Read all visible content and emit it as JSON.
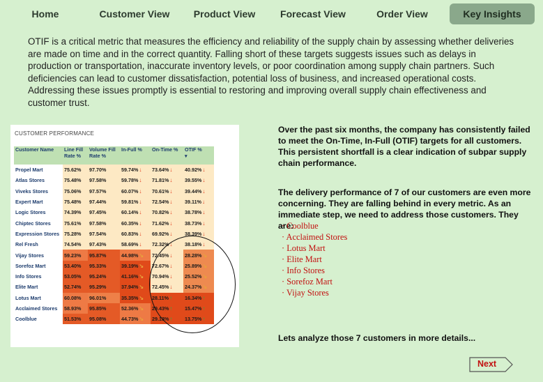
{
  "nav": {
    "items": [
      {
        "label": "Home"
      },
      {
        "label": "Customer View"
      },
      {
        "label": "Product View"
      },
      {
        "label": "Forecast View"
      },
      {
        "label": "Order View"
      },
      {
        "label": "Key Insights",
        "active": true
      }
    ]
  },
  "intro": "OTIF is a critical metric that measures the efficiency and reliability of the supply chain by assessing whether deliveries are made on time and in the correct quantity. Falling short of these targets suggests issues such as delays in production or transportation, inaccurate inventory levels, or poor coordination among supply chain partners. Such deficiencies can lead to customer dissatisfaction, potential loss of business, and increased operational costs. Addressing these issues promptly is essential to restoring and improving overall supply chain effectiveness and customer trust.",
  "table": {
    "title": "CUSTOMER PERFORMANCE",
    "headers": [
      "Customer Name",
      "Line Fill Rate %",
      "Volume Fill Rate %",
      "In-Full %",
      "On-Time %",
      "OTIF %"
    ],
    "sort_indicator": "▾",
    "rows": [
      {
        "name": "Propel Mart",
        "lfr": "75.62%",
        "vfr": "97.70%",
        "inf": "59.74%",
        "ot": "73.64%",
        "otif": "40.92%"
      },
      {
        "name": "Atlas Stores",
        "lfr": "75.48%",
        "vfr": "97.58%",
        "inf": "59.78%",
        "ot": "71.81%",
        "otif": "39.55%"
      },
      {
        "name": "Viveks Stores",
        "lfr": "75.06%",
        "vfr": "97.57%",
        "inf": "60.07%",
        "ot": "70.61%",
        "otif": "39.44%"
      },
      {
        "name": "Expert Mart",
        "lfr": "75.48%",
        "vfr": "97.44%",
        "inf": "59.81%",
        "ot": "72.54%",
        "otif": "39.11%"
      },
      {
        "name": "Logic Stores",
        "lfr": "74.39%",
        "vfr": "97.45%",
        "inf": "60.14%",
        "ot": "70.82%",
        "otif": "38.78%"
      },
      {
        "name": "Chiptec Stores",
        "lfr": "75.61%",
        "vfr": "97.58%",
        "inf": "60.35%",
        "ot": "71.62%",
        "otif": "38.73%"
      },
      {
        "name": "Expression Stores",
        "lfr": "75.28%",
        "vfr": "97.54%",
        "inf": "60.83%",
        "ot": "69.92%",
        "otif": "38.39%"
      },
      {
        "name": "Rel Fresh",
        "lfr": "74.54%",
        "vfr": "97.43%",
        "inf": "58.69%",
        "ot": "72.32%",
        "otif": "38.18%"
      },
      {
        "name": "Vijay Stores",
        "lfr": "59.23%",
        "vfr": "95.87%",
        "inf": "44.98%",
        "ot": "72.45%",
        "otif": "28.28%"
      },
      {
        "name": "Sorefoz Mart",
        "lfr": "53.40%",
        "vfr": "95.33%",
        "inf": "39.19%",
        "ot": "72.67%",
        "otif": "25.89%"
      },
      {
        "name": "Info Stores",
        "lfr": "53.05%",
        "vfr": "95.24%",
        "inf": "41.16%",
        "ot": "70.94%",
        "otif": "25.52%"
      },
      {
        "name": "Elite Mart",
        "lfr": "52.74%",
        "vfr": "95.29%",
        "inf": "37.94%",
        "ot": "72.45%",
        "otif": "24.37%"
      },
      {
        "name": "Lotus Mart",
        "lfr": "60.08%",
        "vfr": "96.01%",
        "inf": "35.35%",
        "ot": "28.11%",
        "otif": "16.34%"
      },
      {
        "name": "Acclaimed Stores",
        "lfr": "58.93%",
        "vfr": "95.85%",
        "inf": "52.36%",
        "ot": "29.43%",
        "otif": "15.47%"
      },
      {
        "name": "Coolblue",
        "lfr": "51.53%",
        "vfr": "95.08%",
        "inf": "44.73%",
        "ot": "29.13%",
        "otif": "13.75%"
      }
    ]
  },
  "insights": {
    "p1": "Over the past six months, the company has consistently failed to meet the On-Time, In-Full (OTIF) targets for all customers. This persistent shortfall is a clear indication of subpar supply chain performance.",
    "p2": "The delivery performance of 7 of our customers are even more concerning. They are falling behind in every metric. As an immediate step, we need to address those customers. They are:",
    "customers": [
      "Coolblue",
      "Acclaimed Stores",
      "Lotus Mart",
      "Elite Mart",
      "Info Stores",
      "Sorefoz Mart",
      "Vijay Stores"
    ],
    "p3": "Lets analyze those 7 customers in more details..."
  },
  "next_label": "Next",
  "colors": {
    "background": "#d6f0cf",
    "nav_active": "#8aa88b",
    "highlight_red": "#c21010",
    "good_cell": "#fde4b8",
    "bad_cell": "#e04a1a"
  }
}
